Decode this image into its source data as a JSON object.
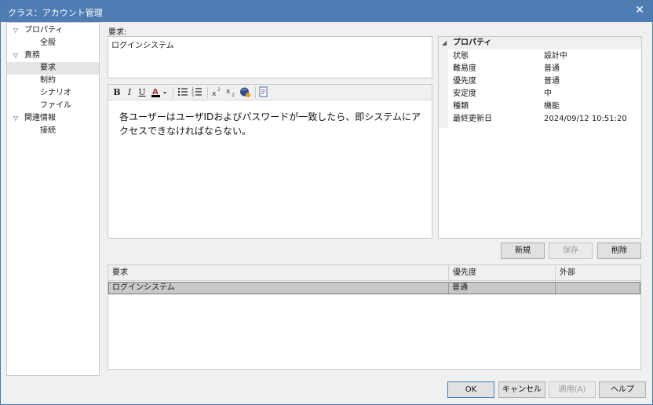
{
  "window": {
    "title": "クラス：アカウント管理",
    "close_glyph": "✕"
  },
  "tree": {
    "items": [
      {
        "label": "プロパティ",
        "expander": "▽",
        "level": 0
      },
      {
        "label": "全般",
        "level": 1
      },
      {
        "label": "責務",
        "expander": "▽",
        "level": 0
      },
      {
        "label": "要求",
        "level": 1,
        "selected": true
      },
      {
        "label": "制約",
        "level": 1
      },
      {
        "label": "シナリオ",
        "level": 1
      },
      {
        "label": "ファイル",
        "level": 1
      },
      {
        "label": "関連情報",
        "expander": "▽",
        "level": 0
      },
      {
        "label": "接続",
        "level": 1
      }
    ]
  },
  "requirement": {
    "label": "要求:",
    "name": "ログインシステム",
    "body": "各ユーザーはユーザIDおよびパスワードが一致したら、即システムにアクセスできなければならない。"
  },
  "toolbar": {
    "bold": "B",
    "italic": "I",
    "underline": "U",
    "font_color": "A",
    "icons": [
      "bold-icon",
      "italic-icon",
      "underline-icon",
      "font-color-icon",
      "bullet-list-icon",
      "numbered-list-icon",
      "superscript-icon",
      "subscript-icon",
      "hyperlink-icon",
      "document-icon"
    ]
  },
  "properties": {
    "header": "プロパティ",
    "rows": [
      {
        "key": "状態",
        "value": "設計中"
      },
      {
        "key": "難易度",
        "value": "普通"
      },
      {
        "key": "優先度",
        "value": "普通"
      },
      {
        "key": "安定度",
        "value": "中"
      },
      {
        "key": "種類",
        "value": "機能"
      },
      {
        "key": "最終更新日",
        "value": "2024/09/12 10:51:20"
      }
    ]
  },
  "actions": {
    "new": "新規",
    "save": "保存",
    "delete": "削除"
  },
  "list": {
    "columns": [
      "要求",
      "優先度",
      "外部"
    ],
    "rows": [
      {
        "name": "ログインシステム",
        "priority": "普通",
        "external": ""
      }
    ]
  },
  "footer": {
    "ok": "OK",
    "cancel": "キャンセル",
    "apply": "適用(A)",
    "help": "ヘルプ"
  },
  "colors": {
    "titlebar": "#4e7db4",
    "selected_row": "#c9c9c9",
    "default_button_border": "#3c7fc4"
  }
}
